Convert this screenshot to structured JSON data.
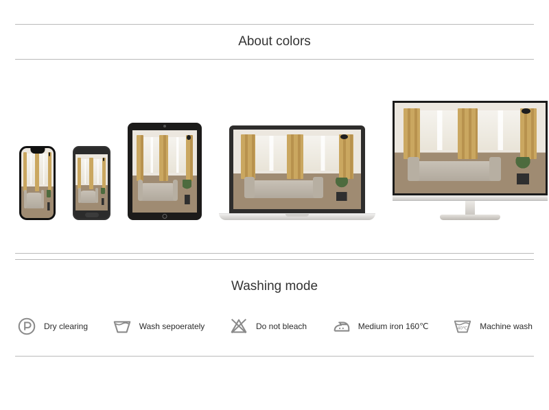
{
  "sections": {
    "colors_heading": "About colors",
    "wash_heading": "Washing mode"
  },
  "devices": [
    {
      "name": "phone-notch"
    },
    {
      "name": "phone-android"
    },
    {
      "name": "tablet"
    },
    {
      "name": "laptop"
    },
    {
      "name": "desktop-monitor"
    }
  ],
  "care": {
    "dry_clean": {
      "label": "Dry clearing",
      "icon": "dry-clean-p-icon"
    },
    "wash_sep": {
      "label": "Wash sepoerately",
      "icon": "wash-basin-icon"
    },
    "no_bleach": {
      "label": "Do not bleach",
      "icon": "no-bleach-icon"
    },
    "iron": {
      "label": "Medium iron 160℃",
      "icon": "iron-icon"
    },
    "machine": {
      "label": "Machine wash",
      "icon": "machine-wash-40-icon",
      "temp": "40℃"
    }
  }
}
